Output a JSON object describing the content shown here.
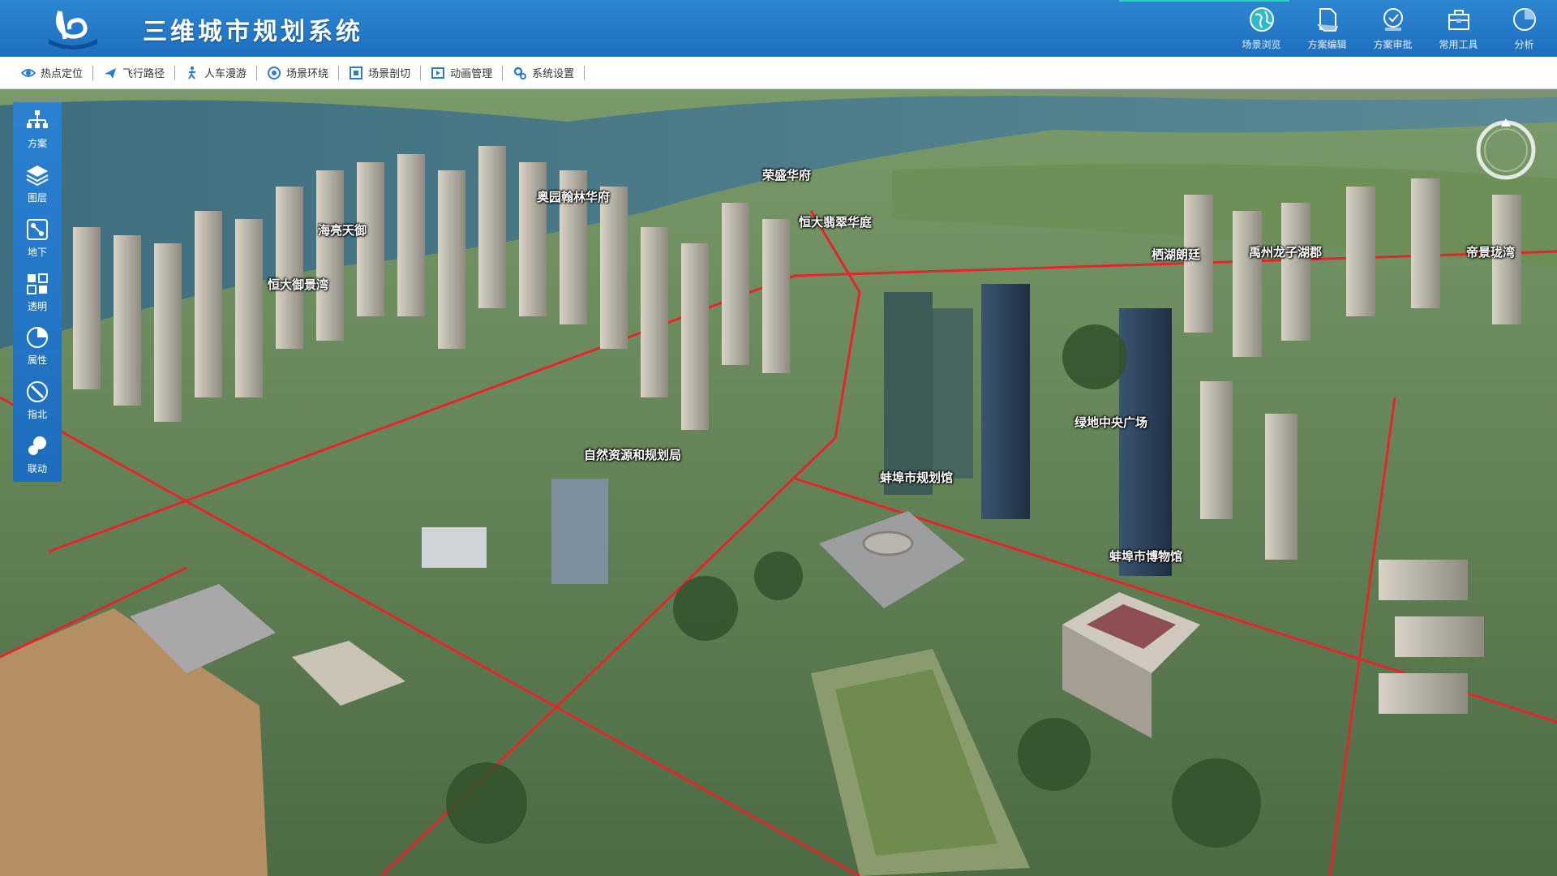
{
  "app": {
    "title": "三维城市规划系统",
    "logo_icon": "city-logo-icon",
    "accent_color": "#1d6fbf"
  },
  "top_nav": [
    {
      "label": "场景浏览",
      "icon": "globe-icon"
    },
    {
      "label": "方案编辑",
      "icon": "document-edit-icon"
    },
    {
      "label": "方案审批",
      "icon": "approval-icon"
    },
    {
      "label": "常用工具",
      "icon": "toolbox-icon"
    },
    {
      "label": "分析",
      "icon": "analysis-icon"
    }
  ],
  "toolbar": [
    {
      "label": "热点定位",
      "icon": "eye-icon"
    },
    {
      "label": "飞行路径",
      "icon": "airplane-icon"
    },
    {
      "label": "人车漫游",
      "icon": "walker-icon"
    },
    {
      "label": "场景环绕",
      "icon": "orbit-icon"
    },
    {
      "label": "场景剖切",
      "icon": "section-cut-icon"
    },
    {
      "label": "动画管理",
      "icon": "animation-icon"
    },
    {
      "label": "系统设置",
      "icon": "settings-icon"
    }
  ],
  "left_panel": [
    {
      "label": "方案",
      "icon": "hierarchy-icon"
    },
    {
      "label": "图层",
      "icon": "layers-icon"
    },
    {
      "label": "地下",
      "icon": "underground-icon"
    },
    {
      "label": "透明",
      "icon": "transparency-icon"
    },
    {
      "label": "属性",
      "icon": "pie-icon"
    },
    {
      "label": "指北",
      "icon": "north-arrow-icon"
    },
    {
      "label": "联动",
      "icon": "link-icon"
    }
  ],
  "map_labels": [
    "荣盛华府",
    "奥园翰林华府",
    "恒大翡翠华庭",
    "海亮天御",
    "恒大御景湾",
    "栖湖朗廷",
    "禹州龙子湖郡",
    "帝景珑湾",
    "绿地中央广场",
    "自然资源和规划局",
    "蚌埠市规划馆",
    "蚌埠市博物馆"
  ]
}
